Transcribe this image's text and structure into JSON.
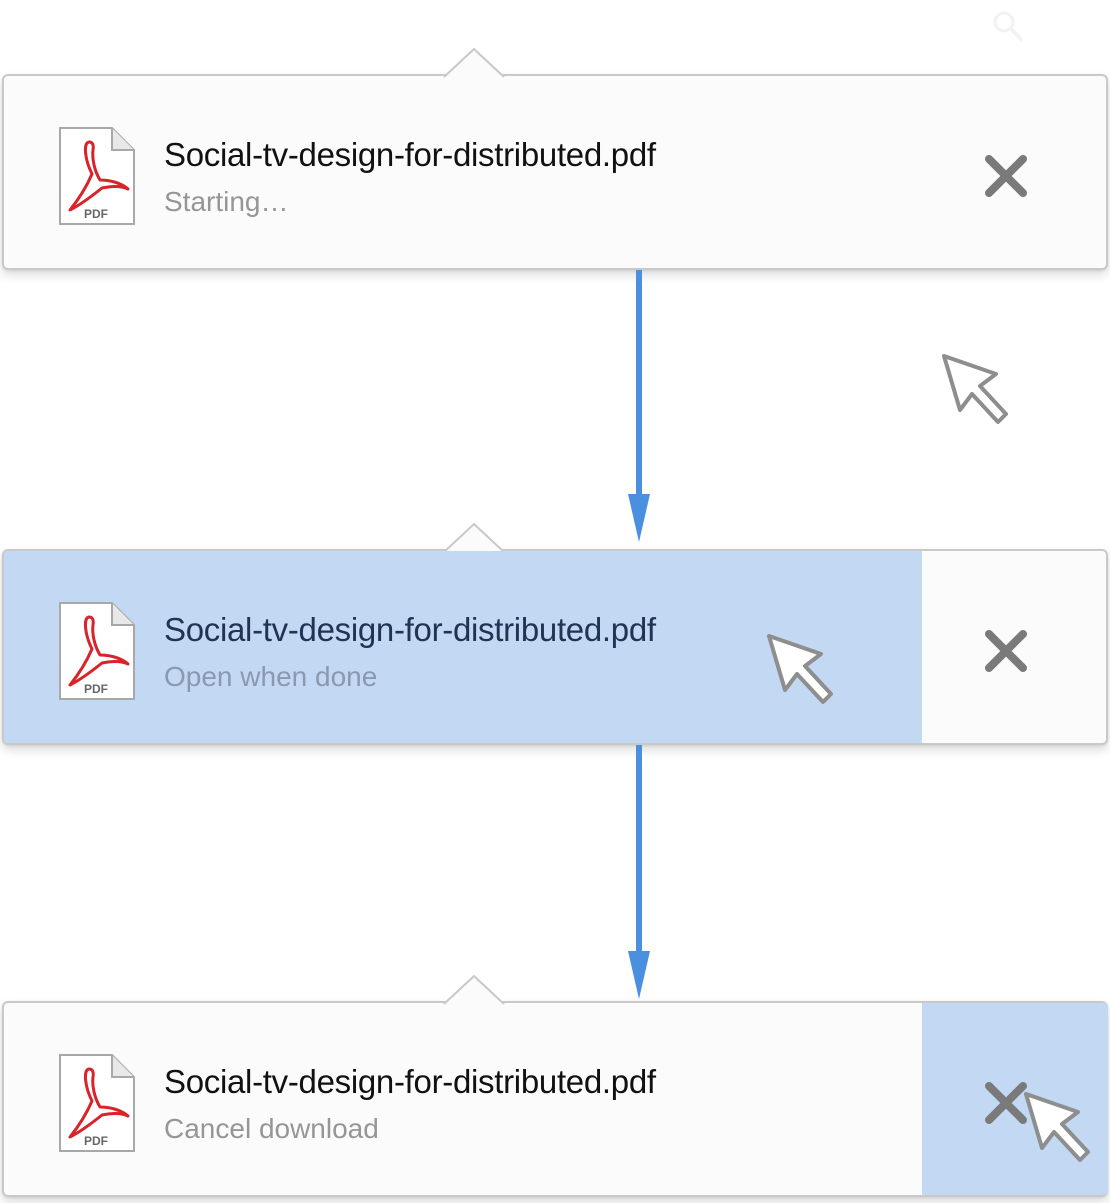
{
  "colors": {
    "highlight": "#c3d8f2",
    "connector_arrow": "#4a8fe0",
    "panel_border": "#c9c9c9",
    "close_icon": "#7a7a7a",
    "pdf_red": "#d9232a"
  },
  "icons": {
    "search": "search-icon",
    "file": "pdf-file-icon",
    "close": "close-icon",
    "pointer": "mouse-pointer-icon",
    "flow": "down-arrow-icon"
  },
  "file_icon_label": "PDF",
  "popovers": [
    {
      "filename": "Social-tv-design-for-distributed.pdf",
      "status": "Starting…",
      "hover_target": "none"
    },
    {
      "filename": "Social-tv-design-for-distributed.pdf",
      "status": "Open when done",
      "hover_target": "row"
    },
    {
      "filename": "Social-tv-design-for-distributed.pdf",
      "status": "Cancel download",
      "hover_target": "close"
    }
  ]
}
